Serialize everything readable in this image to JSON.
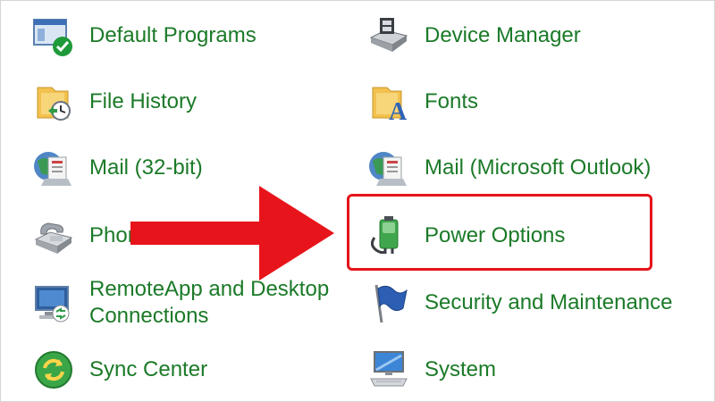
{
  "items": [
    {
      "label": "Default Programs",
      "icon": "default-programs-icon"
    },
    {
      "label": "Device Manager",
      "icon": "device-manager-icon"
    },
    {
      "label": "File History",
      "icon": "file-history-icon"
    },
    {
      "label": "Fonts",
      "icon": "fonts-icon"
    },
    {
      "label": "Mail (32-bit)",
      "icon": "mail-icon"
    },
    {
      "label": "Mail (Microsoft Outlook)",
      "icon": "mail-outlook-icon"
    },
    {
      "label": "Phone and Modem",
      "icon": "phone-modem-icon"
    },
    {
      "label": "Power Options",
      "icon": "power-options-icon"
    },
    {
      "label": "RemoteApp and Desktop Connections",
      "icon": "remoteapp-icon"
    },
    {
      "label": "Security and Maintenance",
      "icon": "security-flag-icon"
    },
    {
      "label": "Sync Center",
      "icon": "sync-center-icon"
    },
    {
      "label": "System",
      "icon": "system-icon"
    }
  ],
  "colors": {
    "link": "#1b7a28",
    "highlight": "#e4141b",
    "arrow": "#e8141b"
  }
}
